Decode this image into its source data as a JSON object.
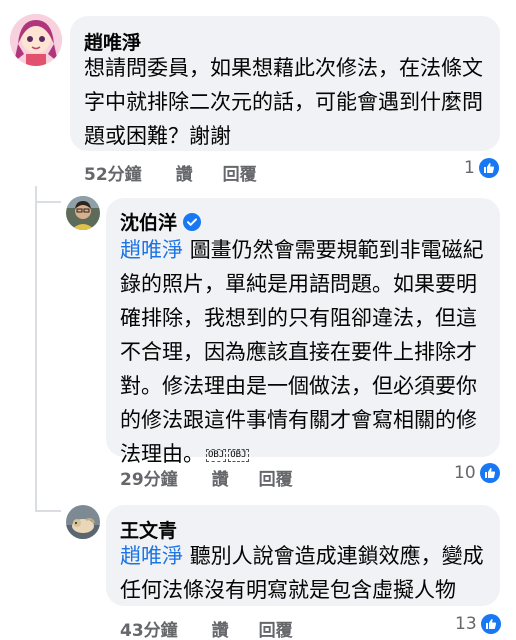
{
  "comments": [
    {
      "author": "趙唯淨",
      "lines": [
        "想請問委員，如果想藉此次修法，在法條文",
        "字中就排除二次元的話，可能會遇到什麼問",
        "題或困難？謝謝"
      ],
      "time": "52分鐘",
      "like_label": "讚",
      "reply_label": "回覆",
      "reaction_count": "1"
    },
    {
      "author": "沈伯洋",
      "mention": "趙唯淨",
      "lines": [
        "圖畫仍然會需要規範到非電磁紀",
        "錄的照片，單純是用語問題。如果要明",
        "確排除，我想到的只有阻卻違法，但這",
        "不合理，因為應該直接在要件上排除才",
        "對。修法理由是一個做法，但必須要你",
        "的修法跟這件事情有關才會寫相關的修",
        "法理由。"
      ],
      "obj_marks": [
        "OBJ",
        "OBJ"
      ],
      "time": "29分鐘",
      "like_label": "讚",
      "reply_label": "回覆",
      "reaction_count": "10"
    },
    {
      "author": "王文青",
      "mention": "趙唯淨",
      "lines": [
        "聽別人說會造成連鎖效應，變成",
        "任何法條沒有明寫就是包含虛擬人物"
      ],
      "time": "43分鐘",
      "like_label": "讚",
      "reply_label": "回覆",
      "reaction_count": "13"
    }
  ],
  "icons": {
    "verified": "verified-badge-icon",
    "like": "thumbs-up-icon"
  },
  "colors": {
    "bubble": "#f0f2f5",
    "mention": "#1b74e4",
    "meta": "#65676b",
    "like_blue": "#1877f2"
  }
}
